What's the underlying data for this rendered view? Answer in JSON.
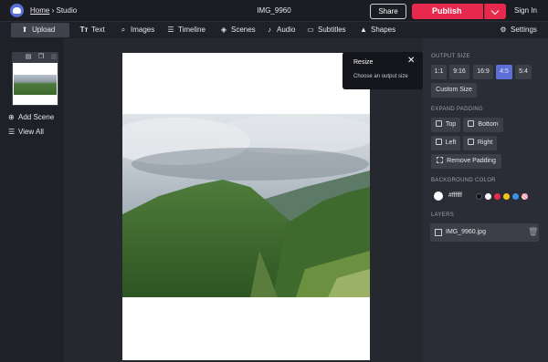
{
  "header": {
    "home_link": "Home",
    "separator": "›",
    "studio_label": "Studio",
    "doc_title": "IMG_9960",
    "share_label": "Share",
    "publish_label": "Publish",
    "signin_label": "Sign In",
    "brand_color": "#e8294e"
  },
  "toolbar": {
    "items": [
      {
        "label": "Upload",
        "icon": "upload-icon"
      },
      {
        "label": "Text",
        "icon": "text-icon"
      },
      {
        "label": "Images",
        "icon": "search-icon"
      },
      {
        "label": "Timeline",
        "icon": "timeline-icon"
      },
      {
        "label": "Scenes",
        "icon": "layers-icon"
      },
      {
        "label": "Audio",
        "icon": "music-note-icon"
      },
      {
        "label": "Subtitles",
        "icon": "subtitles-icon"
      },
      {
        "label": "Shapes",
        "icon": "shapes-icon"
      },
      {
        "label": "Settings",
        "icon": "gear-icon"
      }
    ]
  },
  "scenes": {
    "add_scene": "Add Scene",
    "view_all": "View All"
  },
  "tooltip": {
    "title": "Resize",
    "text": "Choose an output size"
  },
  "right_panel": {
    "output_size_label": "OUTPUT SIZE",
    "sizes": [
      "1:1",
      "9:16",
      "16:9",
      "4:5",
      "5:4"
    ],
    "active_size": "4:5",
    "custom_size": "Custom Size",
    "padding_label": "EXPAND PADDING",
    "padding_options": {
      "top": "Top",
      "bottom": "Bottom",
      "left": "Left",
      "right": "Right",
      "remove": "Remove Padding"
    },
    "bg_color_label": "BACKGROUND COLOR",
    "bg_color_value": "#ffffff",
    "swatches": [
      "#111111",
      "#ffffff",
      "#e8294e",
      "#f5c518",
      "#3f8ee8",
      "#ff9cae"
    ],
    "layers_label": "LAYERS",
    "layer_name": "IMG_9960.jpg",
    "accent_color": "#5c6fd6"
  }
}
